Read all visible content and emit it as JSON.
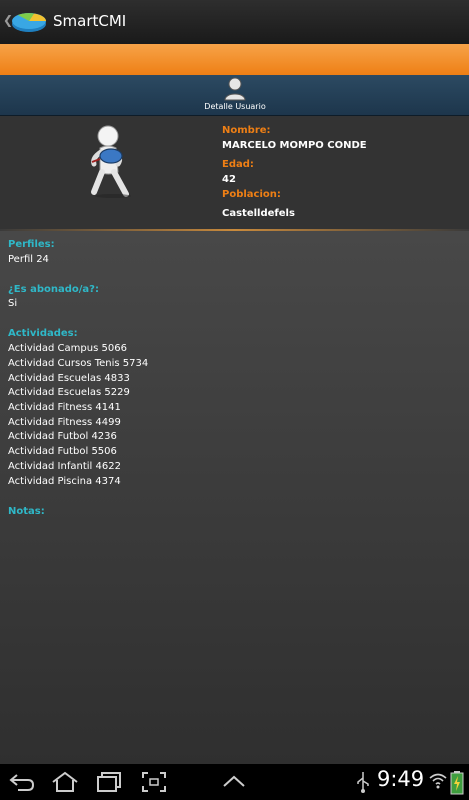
{
  "app": {
    "title": "SmartCMI"
  },
  "tab": {
    "label": "Detalle Usuario"
  },
  "profile": {
    "name_label": "Nombre:",
    "name_value": "MARCELO MOMPO CONDE",
    "age_label": "Edad:",
    "age_value": "42",
    "city_label": "Poblacion:",
    "city_value": "Castelldefels"
  },
  "details": {
    "perfiles_label": "Perfiles:",
    "perfiles_value": "Perfil 24",
    "abonado_label": "¿Es abonado/a?:",
    "abonado_value": "Si",
    "actividades_label": "Actividades:",
    "actividades": [
      "Actividad Campus 5066",
      "Actividad Cursos Tenis 5734",
      "Actividad Escuelas 4833",
      "Actividad Escuelas 5229",
      "Actividad Fitness 4141",
      "Actividad Fitness 4499",
      "Actividad Futbol 4236",
      "Actividad Futbol 5506",
      "Actividad Infantil 4622",
      "Actividad Piscina 4374"
    ],
    "notas_label": "Notas:"
  },
  "status": {
    "time": "9:49"
  },
  "colors": {
    "accent": "#ee7f15",
    "section": "#2fb8c8",
    "tabbar": "#1d364c"
  }
}
